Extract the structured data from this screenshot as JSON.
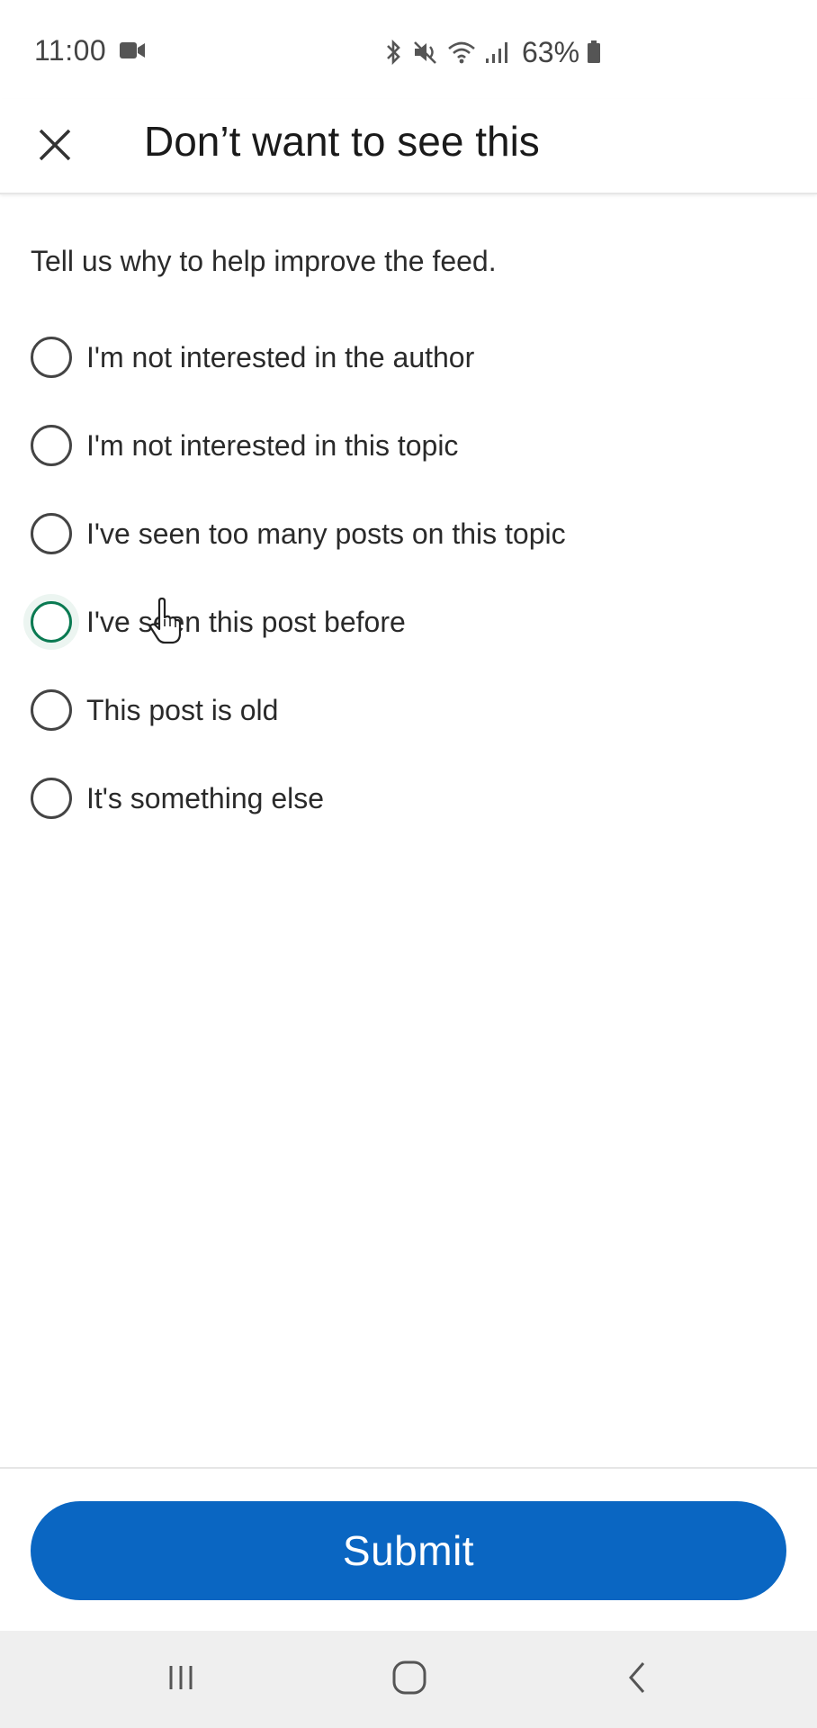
{
  "status_bar": {
    "time": "11:00",
    "battery": "63%",
    "icons": [
      "video-camera-icon",
      "bluetooth-icon",
      "mute-icon",
      "wifi-icon",
      "signal-icon",
      "battery-icon"
    ]
  },
  "header": {
    "title": "Don’t want to see this",
    "close_icon": "close-icon"
  },
  "prompt": "Tell us why to help improve the feed.",
  "options": [
    {
      "label": "I'm not interested in the author"
    },
    {
      "label": "I'm not interested in this topic"
    },
    {
      "label": "I've seen too many posts on this topic"
    },
    {
      "label": "I've seen this post before"
    },
    {
      "label": "This post is old"
    },
    {
      "label": "It's something else"
    }
  ],
  "submit": {
    "label": "Submit"
  },
  "nav_bar": {
    "icons": [
      "recents-icon",
      "home-icon",
      "back-icon"
    ]
  },
  "colors": {
    "accent": "#0a66c2",
    "focus_ring": "#0a7a52",
    "nav_background": "#efefef"
  }
}
